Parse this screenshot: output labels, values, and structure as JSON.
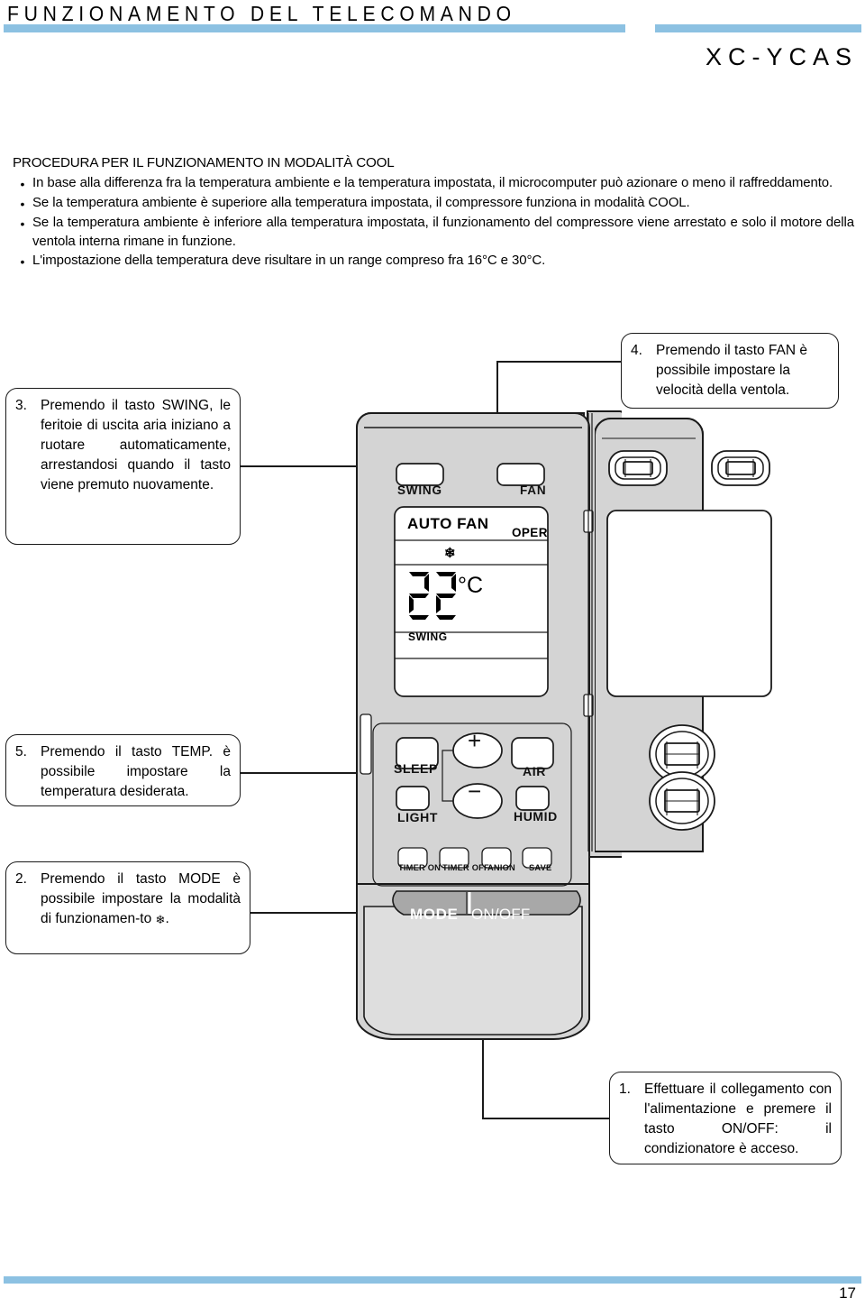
{
  "header": {
    "title": "FUNZIONAMENTO DEL TELECOMANDO",
    "model": "XC-YCAS",
    "rule_color": "#8cc1e2"
  },
  "intro": {
    "heading": "PROCEDURA PER IL FUNZIONAMENTO IN MODALITÀ COOL",
    "bullet_glyph": "•",
    "bullets": [
      "In base alla differenza fra la temperatura ambiente e la temperatura impostata, il microcomputer può azionare o meno il raffreddamento.",
      "Se la temperatura ambiente è superiore alla temperatura impostata, il compressore funziona in modalità COOL.",
      "Se la temperatura ambiente è inferiore alla temperatura impostata, il funzionamento del compressore viene arrestato e solo il motore della ventola interna rimane in funzione.",
      "L'impostazione della temperatura deve risultare in un range compreso fra 16°C e 30°C."
    ]
  },
  "callouts": {
    "c1": {
      "number": "1.",
      "text": "Effettuare il collegamento con l'alimentazione e premere il tasto ON/OFF: il condizionatore è acceso."
    },
    "c2": {
      "number": "2.",
      "text_before": "Premendo il tasto MODE è possibile impostare la modalità di funzionamen-to ",
      "snowflake": "❄",
      "text_after": "."
    },
    "c3": {
      "number": "3.",
      "text": "Premendo il tasto SWING, le feritoie di uscita aria iniziano a ruotare automaticamente, arrestandosi quando il tasto viene premuto nuovamente."
    },
    "c4": {
      "number": "4.",
      "text": "Premendo il tasto FAN è possibile impostare la velocità della ventola."
    },
    "c5": {
      "number": "5.",
      "text": "Premendo il tasto TEMP. è possibile impostare la temperatura desiderata."
    }
  },
  "remote": {
    "buttons": {
      "swing": "SWING",
      "fan": "FAN",
      "sleep": "SLEEP",
      "air": "AIR",
      "light": "LIGHT",
      "humid": "HUMID",
      "timer_on": "TIMER ON",
      "timer_off": "TIMER OFF",
      "anion": "ANION",
      "save": "SAVE",
      "mode": "MODE",
      "on_off": "ON/OFF",
      "plus": "+",
      "minus": "−"
    },
    "lcd": {
      "fan_mode": "AUTO FAN",
      "oper": "OPER",
      "swing": "SWING",
      "temperature": "22",
      "unit": "°C",
      "mode_icon": "❄"
    },
    "body_color": "#d4d4d4",
    "button_bar_color": "#a8a8a8"
  },
  "footer": {
    "page_number": "17",
    "rule_color": "#8cc1e2"
  }
}
